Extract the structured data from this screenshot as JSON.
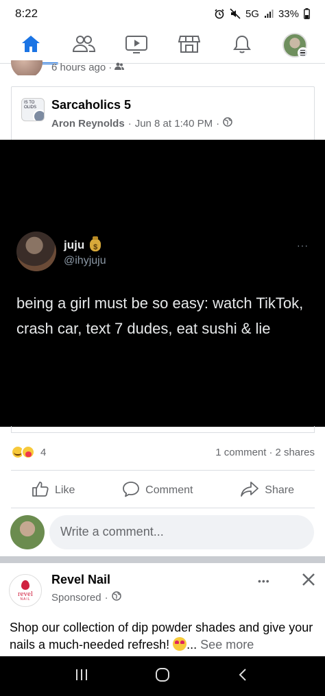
{
  "status_bar": {
    "time": "8:22",
    "network": "5G",
    "battery": "33%"
  },
  "nav": {
    "items": [
      {
        "name": "home",
        "active": true
      },
      {
        "name": "friends",
        "active": false
      },
      {
        "name": "watch",
        "active": false
      },
      {
        "name": "marketplace",
        "active": false
      },
      {
        "name": "notifications",
        "active": false
      },
      {
        "name": "profile-menu",
        "active": false
      }
    ]
  },
  "previous_post": {
    "time": "6 hours ago",
    "separator": "·"
  },
  "shared_post": {
    "thumb_text": "IS TO OLIDS",
    "group": "Sarcaholics 5",
    "author": "Aron Reynolds",
    "separator": "·",
    "timestamp": "Jun 8 at 1:40 PM",
    "separator2": "·"
  },
  "tweet": {
    "display_name": "juju",
    "money_bag_symbol": "$",
    "handle": "@ihyjuju",
    "more": "···",
    "text": "being a girl must be so easy: watch TikTok, crash car, text 7 dudes, eat sushi & lie"
  },
  "reactions": {
    "count": "4",
    "comments": "1 comment",
    "separator": "·",
    "shares": "2 shares"
  },
  "actions": {
    "like": "Like",
    "comment": "Comment",
    "share": "Share"
  },
  "composer": {
    "placeholder": "Write a comment..."
  },
  "ad": {
    "logo_word": "revel",
    "logo_sub": "NAIL",
    "name": "Revel Nail",
    "sponsored": "Sponsored",
    "separator": "·",
    "more": "•••",
    "text": "Shop our collection of dip powder shades and give your nails a much-needed refresh! ",
    "ellipsis": "...",
    "see_more": "See more"
  },
  "colors": {
    "accent": "#1b74e4",
    "secondary_text": "#65676b",
    "tweet_background": "#000000"
  }
}
